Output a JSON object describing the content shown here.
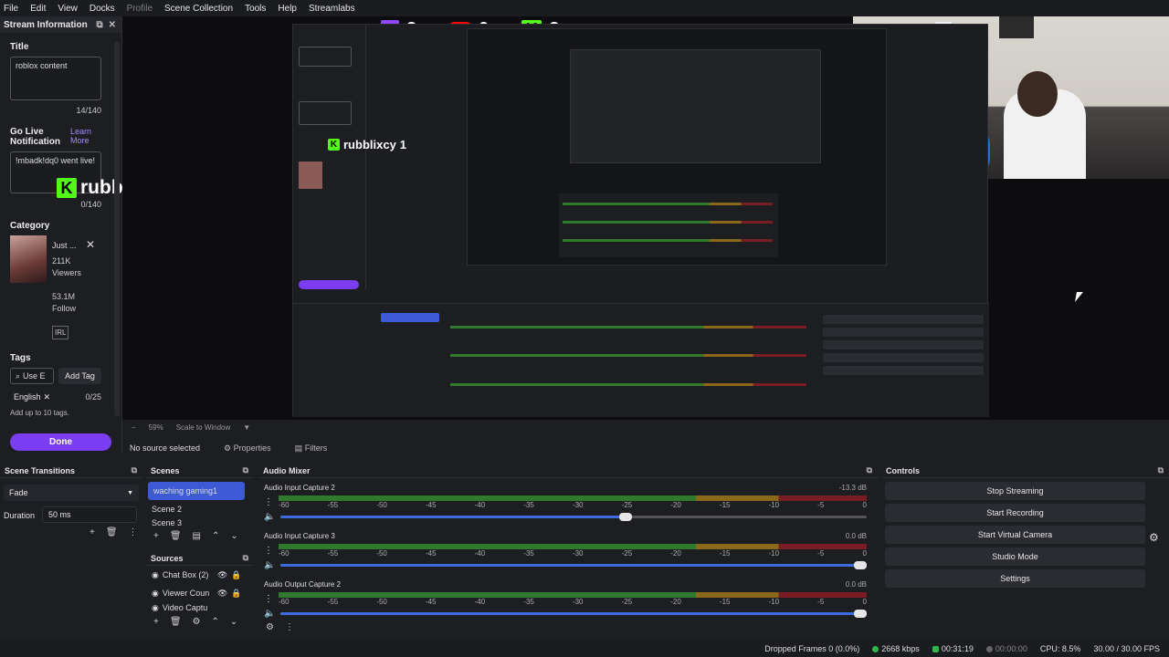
{
  "menu": {
    "items": [
      "File",
      "Edit",
      "View",
      "Docks",
      "Profile",
      "Scene Collection",
      "Tools",
      "Help",
      "Streamlabs"
    ]
  },
  "stream_info": {
    "dock_title": "Stream Information",
    "title_label": "Title",
    "title_value": "roblox content",
    "title_count": "14/140",
    "golive_label_1": "Go Live",
    "golive_label_2": "Notification",
    "learn": "Learn",
    "more": "More",
    "golive_value": "!mbadk!dq0 went live!",
    "golive_count": "0/140",
    "overlay_name": "rubblixcy",
    "overlay_count": "1",
    "category_label": "Category",
    "category_name": "Just ...",
    "category_viewers": "211K",
    "viewers_word": "Viewers",
    "category_followers": "53.1M",
    "follow_word": "Follow",
    "irl": "IRL",
    "tags_label": "Tags",
    "tag_input": "Use E",
    "add_tag": "Add Tag",
    "tag": "English",
    "tag_count": "0/25",
    "tag_hint": "Add up to 10 tags.",
    "done": "Done"
  },
  "overlay": {
    "twitch_count": "2",
    "youtube_count": "0",
    "kick_count": "2",
    "kick_letter": "K"
  },
  "preview_bar": {
    "zoom": "59%",
    "scale": "Scale to Window"
  },
  "source_bar": {
    "no_source": "No source selected",
    "properties": "Properties",
    "filters": "Filters"
  },
  "transitions": {
    "title": "Scene Transitions",
    "type": "Fade",
    "duration_label": "Duration",
    "duration_value": "50 ms"
  },
  "scenes": {
    "title": "Scenes",
    "items": [
      "waching gaming1",
      "Scene 2",
      "Scene 3"
    ]
  },
  "sources": {
    "title": "Sources",
    "items": [
      "Chat Box (2)",
      "Viewer Coun",
      "Video Captu"
    ]
  },
  "mixer": {
    "title": "Audio Mixer",
    "ticks": [
      "-60",
      "-55",
      "-50",
      "-45",
      "-40",
      "-35",
      "-30",
      "-25",
      "-20",
      "-15",
      "-10",
      "-5",
      "0"
    ],
    "channels": [
      {
        "name": "Audio Input Capture 2",
        "db": "-13.3 dB",
        "level": 0.6
      },
      {
        "name": "Audio Input Capture 3",
        "db": "0.0 dB",
        "level": 1.0
      },
      {
        "name": "Audio Output Capture 2",
        "db": "0.0 dB",
        "level": 1.0
      }
    ]
  },
  "controls": {
    "title": "Controls",
    "buttons": [
      "Stop Streaming",
      "Start Recording",
      "Start Virtual Camera",
      "Studio Mode",
      "Settings"
    ]
  },
  "status": {
    "dropped": "Dropped Frames 0 (0.0%)",
    "kbps": "2668 kbps",
    "live_time": "00:31:19",
    "rec_time": "00:00:00",
    "cpu": "CPU: 8.5%",
    "fps": "30.00 / 30.00 FPS"
  },
  "colors": {
    "accent": "#7a3df2",
    "selection": "#3d5ad6",
    "kick": "#53fc18",
    "twitch": "#9146ff",
    "youtube": "#ff0000"
  }
}
